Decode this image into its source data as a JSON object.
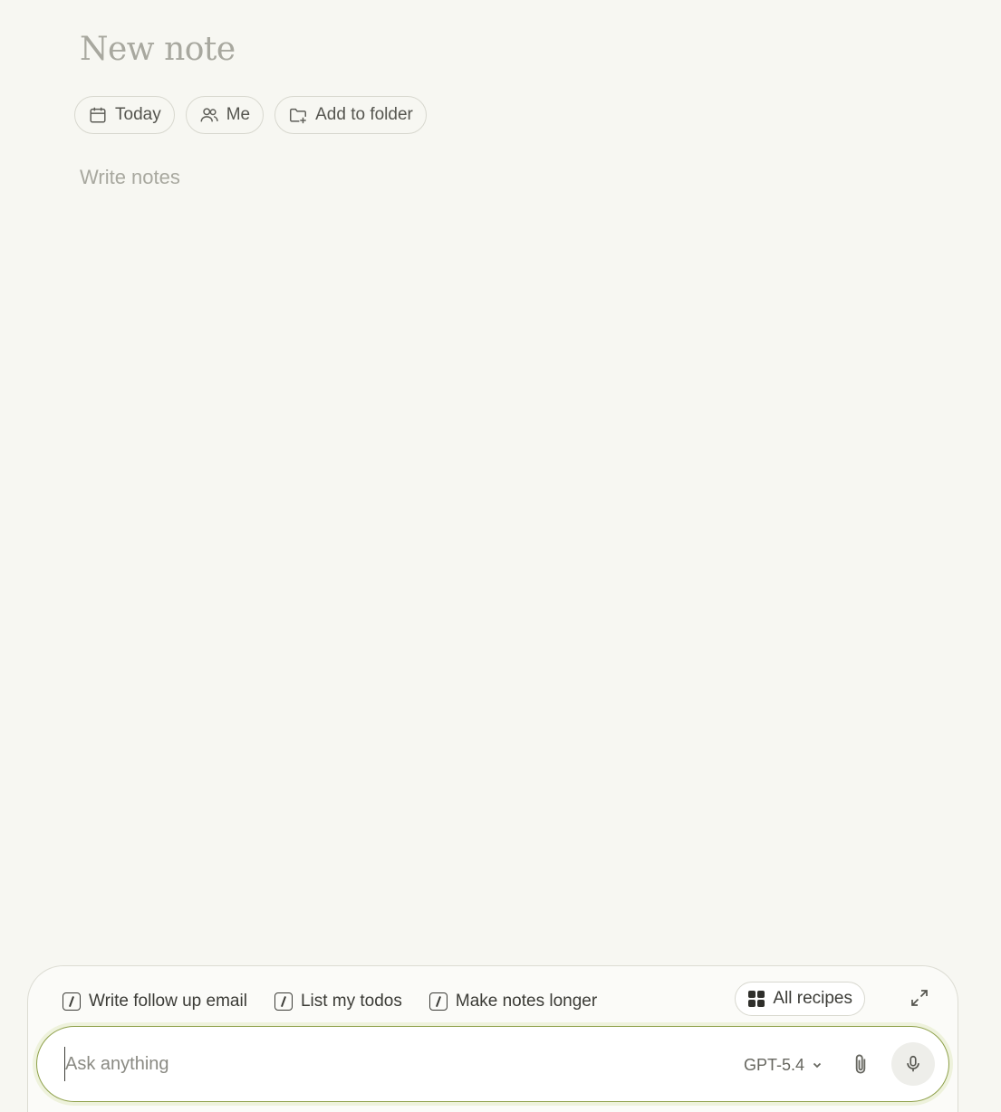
{
  "note": {
    "title_placeholder": "New note",
    "body_placeholder": "Write notes"
  },
  "chips": [
    {
      "label": "Today",
      "icon": "calendar-icon"
    },
    {
      "label": "Me",
      "icon": "people-icon"
    },
    {
      "label": "Add to folder",
      "icon": "folder-plus-icon"
    }
  ],
  "chat": {
    "recipes": [
      {
        "label": "Write follow up email",
        "icon": "slash-command-icon"
      },
      {
        "label": "List my todos",
        "icon": "slash-command-icon"
      },
      {
        "label": "Make notes longer",
        "icon": "slash-command-icon"
      }
    ],
    "all_recipes_label": "All recipes",
    "input_placeholder": "Ask anything",
    "model": "GPT-5.4"
  },
  "colors": {
    "background": "#f7f7f2",
    "input_focus_border": "#8ea04a"
  }
}
